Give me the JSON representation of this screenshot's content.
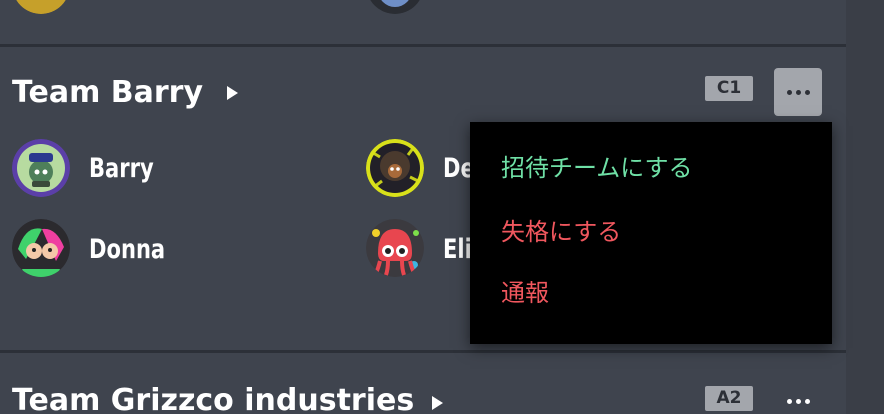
{
  "teams": [
    {
      "name": "Team Barry",
      "seed": "C1",
      "members": [
        {
          "name": "Barry",
          "avatar": "purple-ring-character-avatar"
        },
        {
          "name": "De",
          "avatar": "spiky-dark-avatar"
        },
        {
          "name": "Donna",
          "avatar": "green-pink-inkling-avatar"
        },
        {
          "name": "Eli",
          "avatar": "red-octopus-avatar"
        }
      ]
    },
    {
      "name": "Team Grizzco industries",
      "seed": "A2"
    }
  ],
  "dropdown": {
    "items": [
      {
        "label": "招待チームにする",
        "color": "#6fe0a6"
      },
      {
        "label": "失格にする",
        "color": "#f0575e"
      },
      {
        "label": "通報",
        "color": "#f0575e"
      }
    ]
  },
  "colors": {
    "background": "#3f444e",
    "separator": "#2c3038",
    "badge": "#a3a6ac",
    "menu_background": "#000000"
  }
}
